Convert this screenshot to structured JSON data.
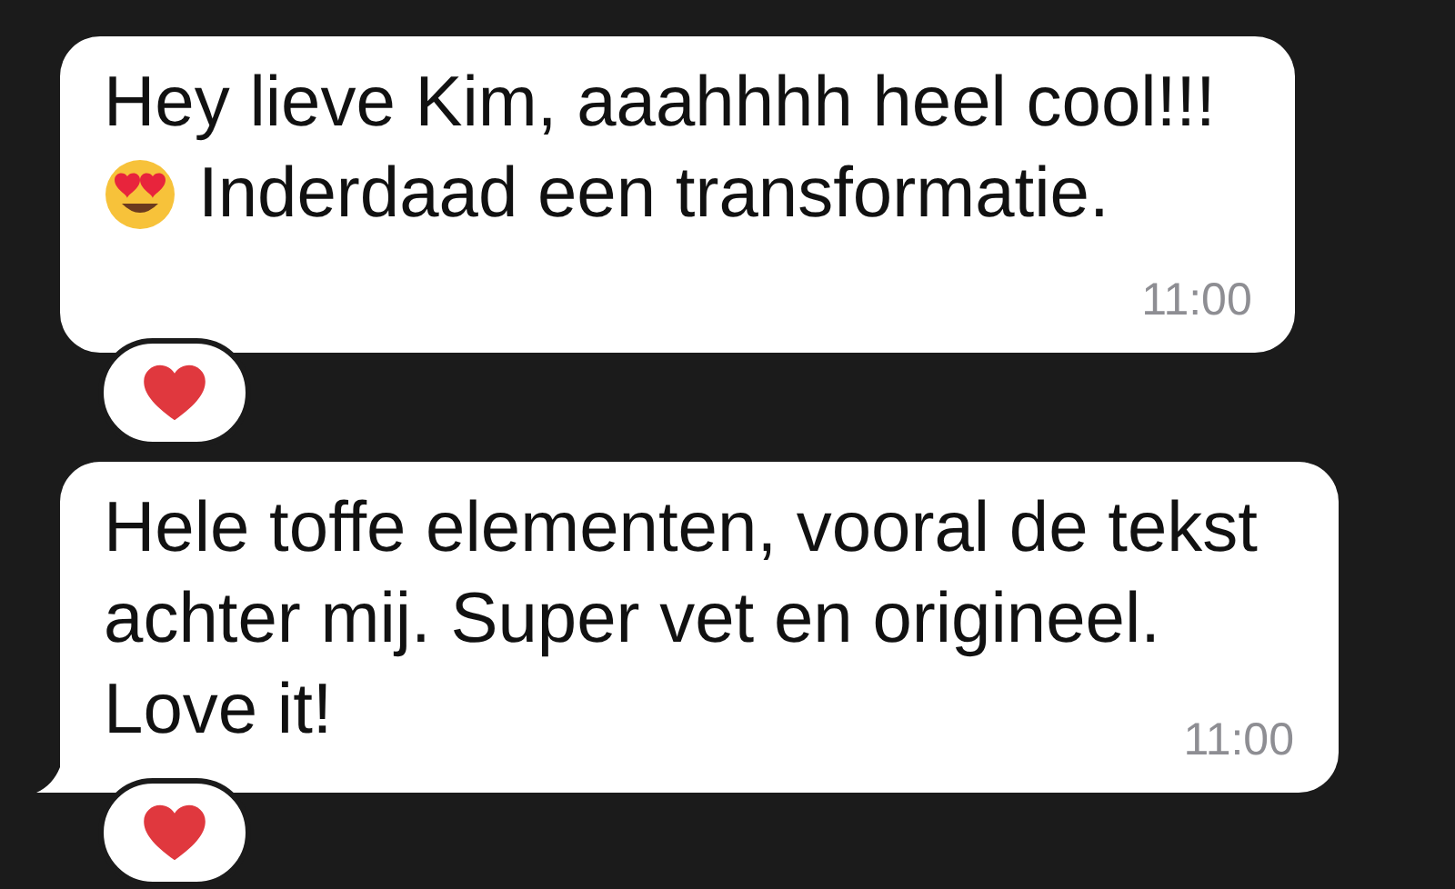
{
  "messages": [
    {
      "lines": [
        {
          "text": "Hey lieve Kim, aaahhhh heel cool!!!",
          "emoji": false
        },
        {
          "emoji": true,
          "text": "Inderdaad een transformatie."
        }
      ],
      "time": "11:00",
      "tail": false,
      "reaction": {
        "kind": "heart"
      }
    },
    {
      "lines": [
        {
          "text": "Hele toffe elementen, vooral de tekst",
          "emoji": false
        },
        {
          "text": "achter mij. Super vet en origineel.",
          "emoji": false
        },
        {
          "text": "Love it!",
          "emoji": false
        }
      ],
      "time": "11:00",
      "tail": true,
      "reaction": {
        "kind": "heart"
      }
    }
  ]
}
